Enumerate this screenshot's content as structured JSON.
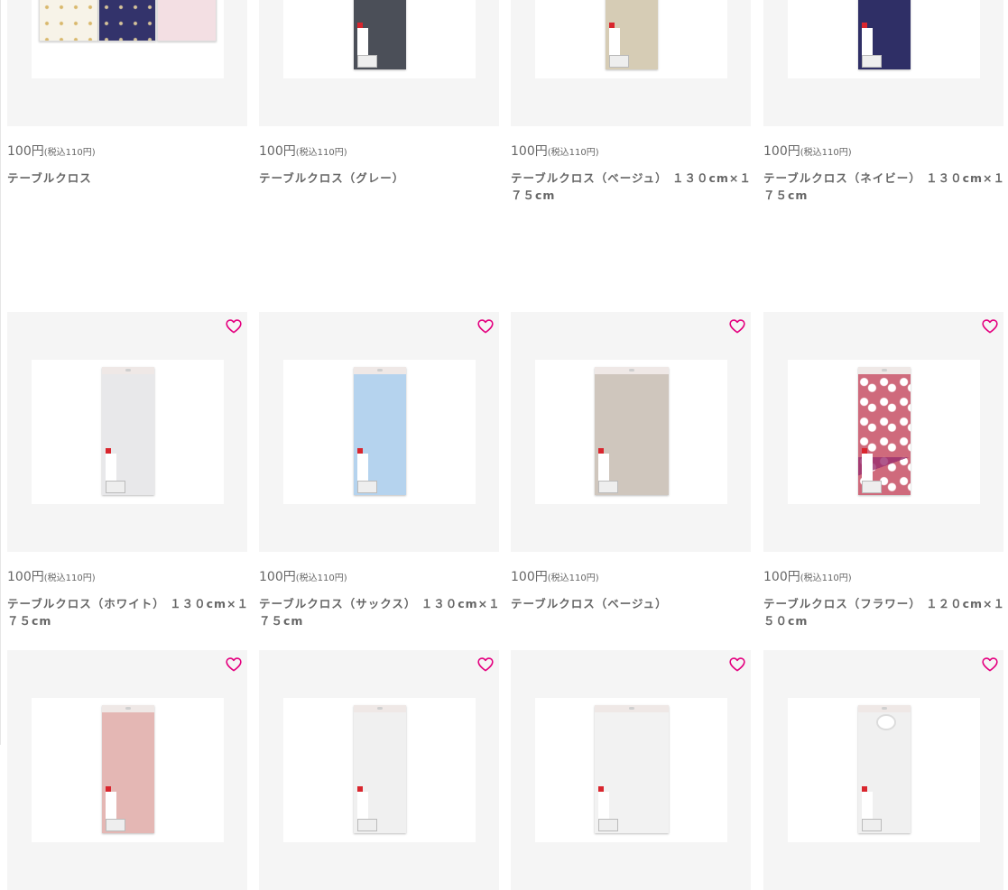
{
  "colors": {
    "accent_heart": "#e4007f",
    "card_bg": "#f5f5f5"
  },
  "products": [
    {
      "price": "100円",
      "tax": "(税込110円)",
      "name": "テーブルクロス",
      "color": "#f7f3e8",
      "style": "set"
    },
    {
      "price": "100円",
      "tax": "(税込110円)",
      "name": "テーブルクロス（グレー）",
      "color": "#4b4f58",
      "style": "pkg"
    },
    {
      "price": "100円",
      "tax": "(税込110円)",
      "name": "テーブルクロス（ベージュ） １３０cm×１７５cm",
      "color": "#d6ccb5",
      "style": "pkg"
    },
    {
      "price": "100円",
      "tax": "(税込110円)",
      "name": "テーブルクロス（ネイビー） １３０cm×１７５cm",
      "color": "#2f2f66",
      "style": "pkg"
    },
    {
      "price": "100円",
      "tax": "(税込110円)",
      "name": "テーブルクロス（ホワイト） １３０cm×１７５cm",
      "color": "#e8e8ea",
      "style": "pkg"
    },
    {
      "price": "100円",
      "tax": "(税込110円)",
      "name": "テーブルクロス（サックス） １３０cm×１７５cm",
      "color": "#b5d3ee",
      "style": "pkg"
    },
    {
      "price": "100円",
      "tax": "(税込110円)",
      "name": "テーブルクロス（ベージュ）",
      "color": "#cfc6bd",
      "style": "pkg-wide"
    },
    {
      "price": "100円",
      "tax": "(税込110円)",
      "name": "テーブルクロス（フラワー） １２０cm×１５０cm",
      "color": "#cf6a7c",
      "style": "pkg-flower"
    },
    {
      "price": "",
      "tax": "",
      "name": "",
      "color": "#e4b7b4",
      "style": "pkg"
    },
    {
      "price": "",
      "tax": "",
      "name": "",
      "color": "#f0f0f0",
      "style": "pkg"
    },
    {
      "price": "",
      "tax": "",
      "name": "",
      "color": "#f2f2f2",
      "style": "pkg-wide"
    },
    {
      "price": "",
      "tax": "",
      "name": "",
      "color": "#f0f0f0",
      "style": "pkg-round"
    }
  ]
}
